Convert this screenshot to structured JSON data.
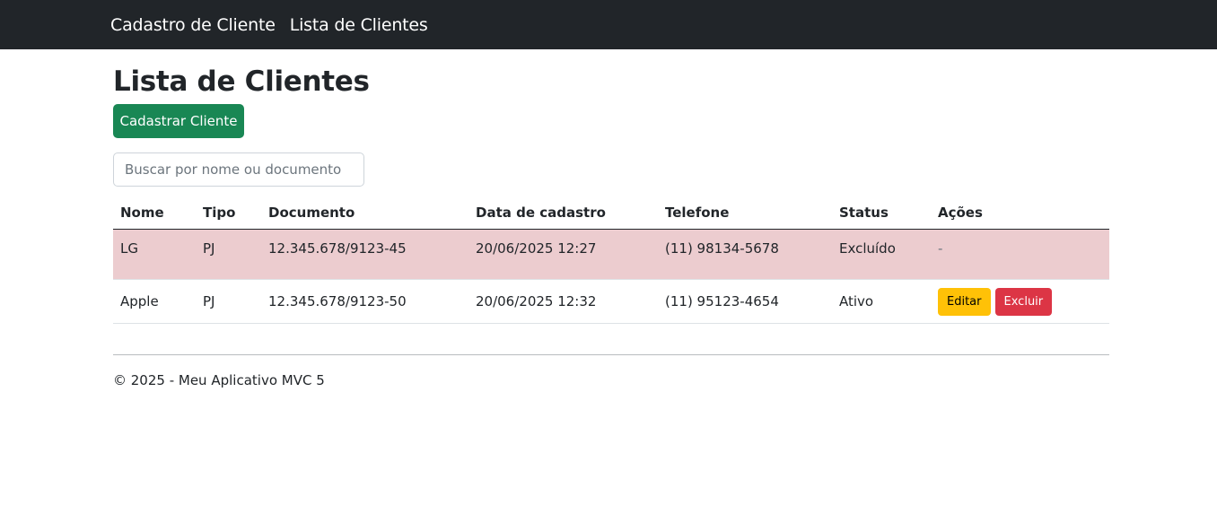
{
  "nav": {
    "brand": "Cadastro de Cliente",
    "link_list": "Lista de Clientes"
  },
  "page": {
    "title": "Lista de Clientes",
    "register_button": "Cadastrar Cliente",
    "search_placeholder": "Buscar por nome ou documento"
  },
  "table": {
    "headers": [
      "Nome",
      "Tipo",
      "Documento",
      "Data de cadastro",
      "Telefone",
      "Status",
      "Ações"
    ],
    "rows": [
      {
        "nome": "LG",
        "tipo": "PJ",
        "documento": "12.345.678/9123-45",
        "data": "20/06/2025 12:27",
        "telefone": "(11) 98134-5678",
        "status": "Excluído",
        "acoes": "-"
      },
      {
        "nome": "Apple",
        "tipo": "PJ",
        "documento": "12.345.678/9123-50",
        "data": "20/06/2025 12:32",
        "telefone": "(11) 95123-4654",
        "status": "Ativo",
        "edit_label": "Editar",
        "delete_label": "Excluir"
      }
    ]
  },
  "footer": {
    "text": "© 2025 - Meu Aplicativo MVC 5"
  },
  "colors": {
    "navbar": "#212529",
    "success": "#198754",
    "warning": "#ffc107",
    "danger": "#dc3545",
    "deleted_row": "#eccccf"
  }
}
